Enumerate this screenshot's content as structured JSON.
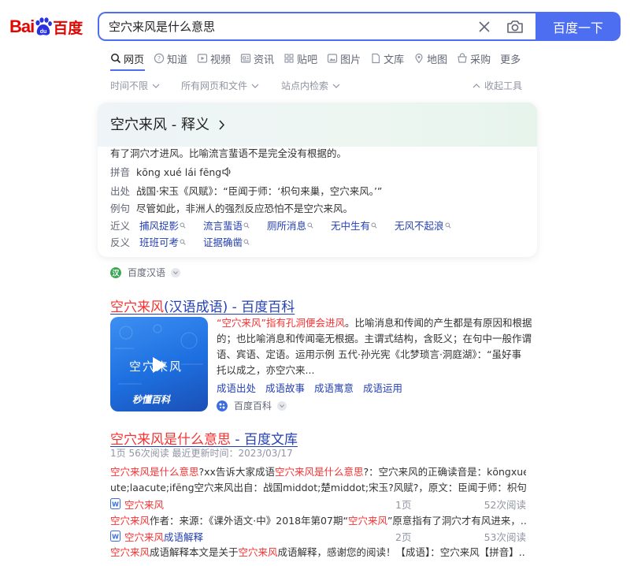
{
  "header": {
    "logo_text_left": "Bai",
    "logo_text_right": "百度",
    "logo_paw_text": "du",
    "search_value": "空穴来风是什么意思",
    "search_button": "百度一下"
  },
  "tabs": [
    {
      "label": "网页",
      "icon": "search-icon",
      "active": true
    },
    {
      "label": "知道",
      "icon": "question-icon"
    },
    {
      "label": "视频",
      "icon": "video-icon"
    },
    {
      "label": "资讯",
      "icon": "news-icon"
    },
    {
      "label": "贴吧",
      "icon": "tieba-icon"
    },
    {
      "label": "图片",
      "icon": "image-icon"
    },
    {
      "label": "文库",
      "icon": "doc-icon"
    },
    {
      "label": "地图",
      "icon": "map-icon"
    },
    {
      "label": "采购",
      "icon": "purchase-icon"
    },
    {
      "label": "更多"
    }
  ],
  "filters": {
    "time": "时间不限",
    "type": "所有网页和文件",
    "site": "站点内检索",
    "collapse": "收起工具"
  },
  "card": {
    "title": "空穴来风 - 释义",
    "definition": "有了洞穴才进风。比喻流言蜚语不是完全没有根据的。",
    "pinyin_label": "拼音",
    "pinyin": "kōng xué lái fēng",
    "source_label": "出处",
    "source": "战国·宋玉《风赋》：“臣闻于师：‘枳句来巢，空穴来风。’”",
    "example_label": "例句",
    "example": "尽管如此，非洲人的强烈反应恐怕不是空穴来风。",
    "synonyms_label": "近义",
    "synonyms": [
      "捕风捉影",
      "流言蜚语",
      "厕所消息",
      "无中生有",
      "无风不起浪"
    ],
    "antonyms_label": "反义",
    "antonyms": [
      "班班可考",
      "证据确凿"
    ],
    "source_name": "百度汉语"
  },
  "result1": {
    "title_em": "空穴来风",
    "title_rest": "(汉语成语) - 百度百科",
    "thumb_text": "空穴来风",
    "thumb_caption": "秒懂百科",
    "snippet_em": "“空穴来风”指有孔洞便会进风",
    "snippet_line1_rest": "。比喻消息和传闻的产生都是有原因和根据",
    "snippet_line2": "的；也比喻消息和传闻毫无根据。主谓式结构，含贬义；在句中一般作谓",
    "snippet_line3": "语、宾语、定语。运用示例 五代·孙光宪《北梦琐言·洞庭湖》：“虽好事",
    "snippet_line4": "托以成之，亦空穴来...",
    "links": [
      "成语出处",
      "成语故事",
      "成语寓意",
      "成语运用"
    ],
    "source_name": "百度百科"
  },
  "result2": {
    "title_em": "空穴来风是什么意思",
    "title_rest": " - 百度文库",
    "meta": "1页   56次阅读   最近更新时间：2023/03/17",
    "desc1_em1": "空穴来风是什么意思",
    "desc1_mid": "?xx告诉大家成语",
    "desc1_em2": "空穴来风是什么意思",
    "desc1_rest": "?：空穴来风的正确读音是：kōngxueac",
    "desc2": "ute;laacute;ifēng空穴来风出自：战国middot;楚middot;宋玉?风赋?，原文：臣闻于师：枳句来巢...",
    "docs": [
      {
        "title_em": "空穴来风",
        "title_rest": "",
        "pages": "1页",
        "reads": "52次阅读",
        "desc_em": "空穴来风",
        "desc_mid": "作者：来源：《课外语文·中》2018年第07期“",
        "desc_em2": "空穴来风",
        "desc_rest": "”原意指有了洞穴才有风进来，..."
      },
      {
        "title_em": "空穴来风",
        "title_rest": "成语解释",
        "pages": "2页",
        "reads": "53次阅读",
        "desc_em": "空穴来风",
        "desc_mid": "成语解释本文是关于",
        "desc_em2": "空穴来风",
        "desc_rest": "成语解释，感谢您的阅读！【成语】：空穴来风【拼音】..."
      }
    ]
  },
  "colors": {
    "brand_blue": "#4e6ef2",
    "link_blue": "#2440b3",
    "highlight_red": "#f73131",
    "logo_red": "#e10602"
  }
}
